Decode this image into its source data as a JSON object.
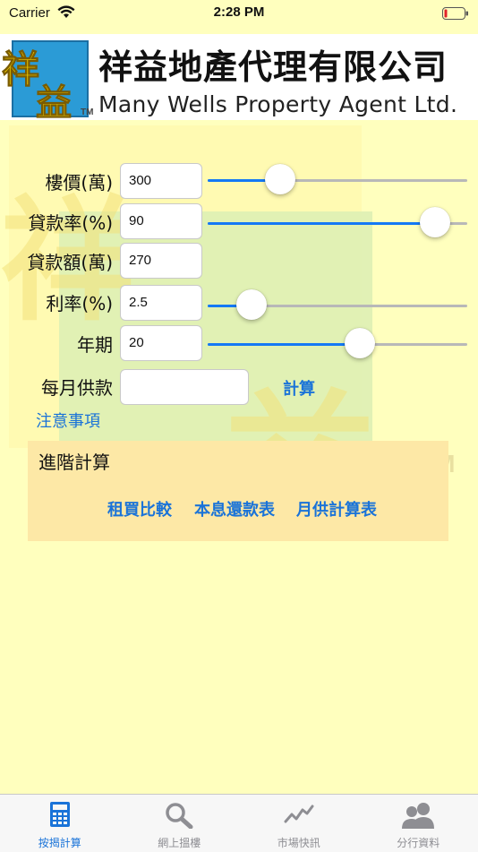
{
  "status_bar": {
    "carrier": "Carrier",
    "time": "2:28 PM"
  },
  "header": {
    "company_cn": "祥益地產代理有限公司",
    "company_en": "Many Wells Property Agent Ltd.",
    "logo_text": "祥益"
  },
  "watermark": {
    "tm": "TM"
  },
  "form": {
    "price": {
      "label": "樓價(萬)",
      "value": "300",
      "slider_fraction": 0.28
    },
    "loan_ratio": {
      "label": "貸款率(%)",
      "value": "90",
      "slider_fraction": 0.875
    },
    "loan_amount": {
      "label": "貸款額(萬)",
      "value": "270"
    },
    "rate": {
      "label": "利率(%)",
      "value": "2.5",
      "slider_fraction": 0.168
    },
    "years": {
      "label": "年期",
      "value": "20",
      "slider_fraction": 0.585
    },
    "monthly": {
      "label": "每月供款",
      "value": ""
    },
    "calculate_label": "計算",
    "notice_label": "注意事項"
  },
  "advanced": {
    "title": "進階計算",
    "buttons": [
      "租買比較",
      "本息還款表",
      "月供計算表"
    ]
  },
  "tab_bar": {
    "tabs": [
      {
        "label": "按揭計算",
        "icon": "calculator-icon",
        "active": true
      },
      {
        "label": "網上搵樓",
        "icon": "search-icon",
        "active": false
      },
      {
        "label": "市場快訊",
        "icon": "chart-icon",
        "active": false
      },
      {
        "label": "分行資料",
        "icon": "people-icon",
        "active": false
      }
    ]
  },
  "colors": {
    "accent": "#1a73d8",
    "background": "#ffffbe",
    "panel": "#fde8a6"
  }
}
